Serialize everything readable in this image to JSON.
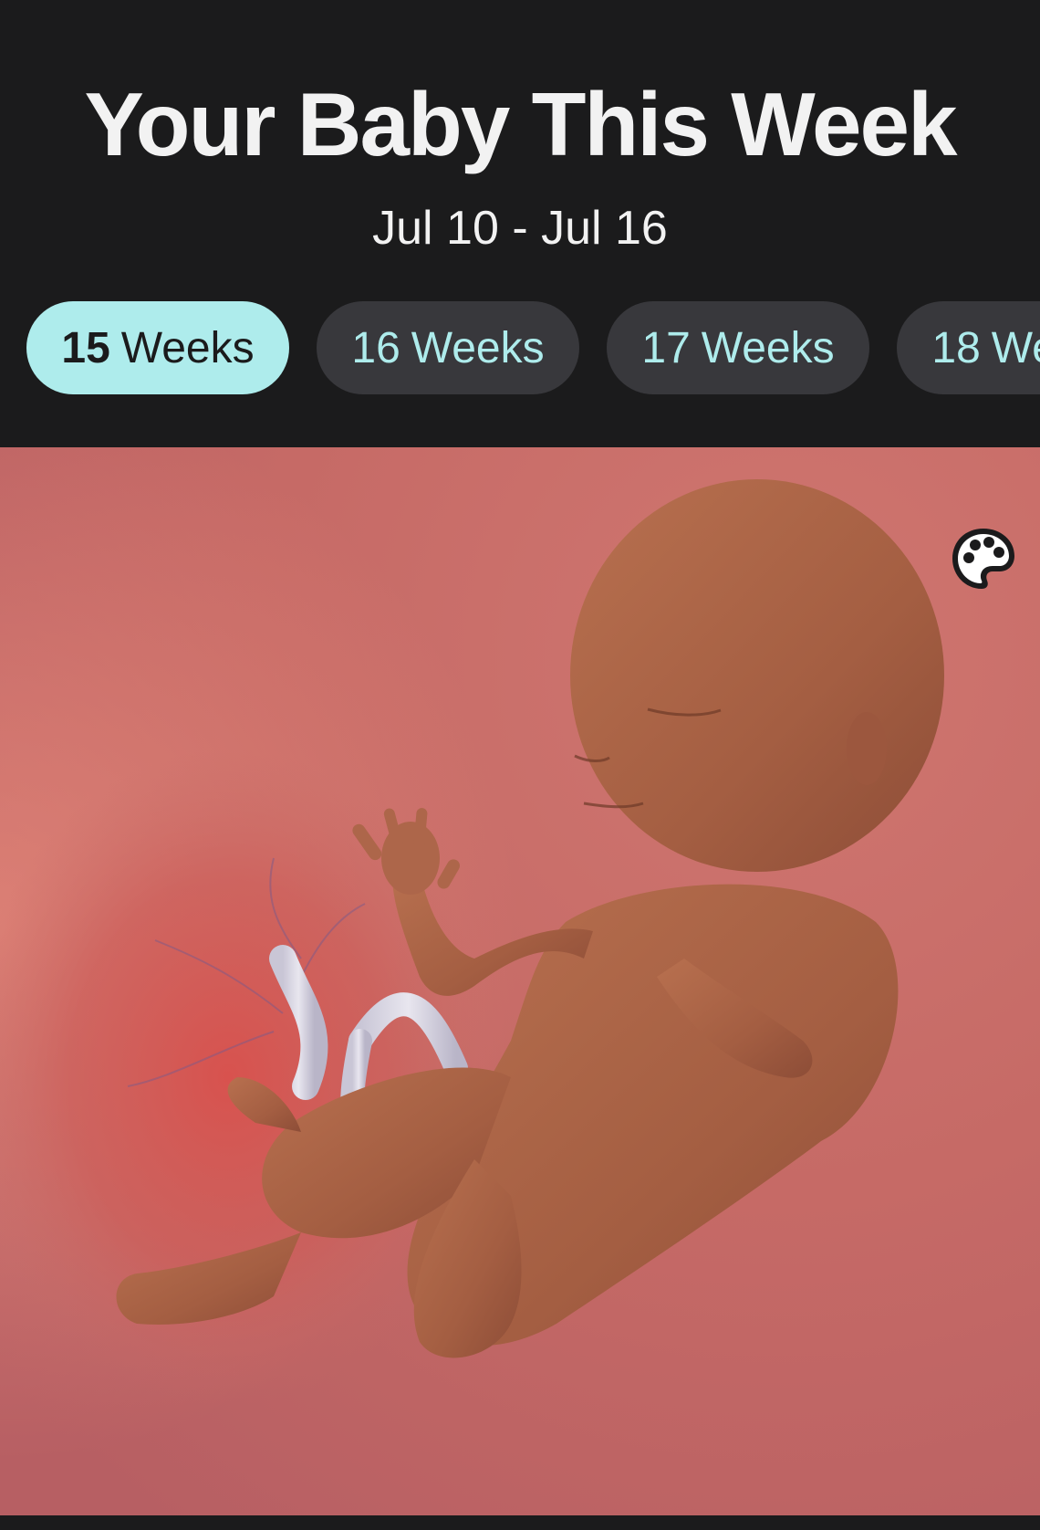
{
  "header": {
    "title": "Your Baby This Week",
    "date_range": "Jul 10 - Jul 16"
  },
  "tabs": [
    {
      "number": "15",
      "label": "Weeks",
      "active": true
    },
    {
      "number": "16",
      "label": "Weeks",
      "active": false
    },
    {
      "number": "17",
      "label": "Weeks",
      "active": false
    },
    {
      "number": "18",
      "label": "Weeks",
      "active": false
    }
  ],
  "icons": {
    "palette": "palette-icon"
  },
  "colors": {
    "background": "#1b1b1c",
    "accent": "#aeecec",
    "tab_inactive": "#38383c",
    "text_light": "#f2f2f2"
  }
}
